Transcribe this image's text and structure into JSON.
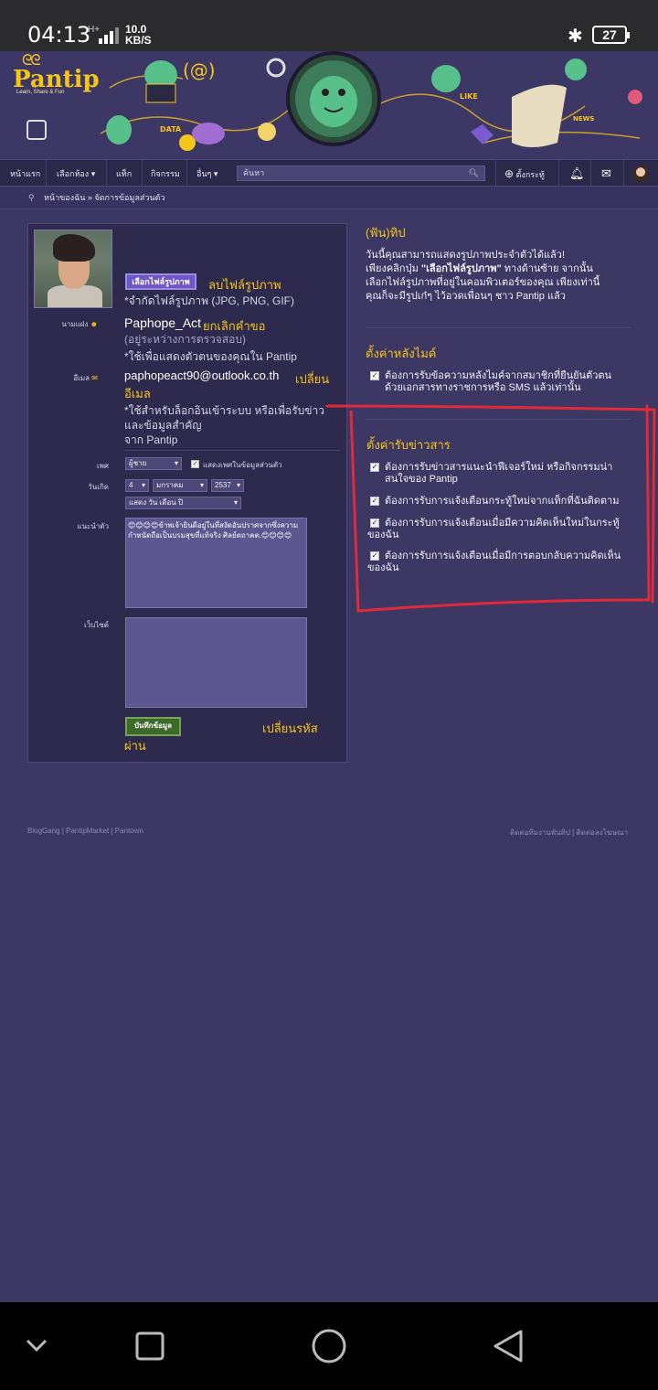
{
  "status": {
    "time": "04:13",
    "network": "H+",
    "speed_value": "10.0",
    "speed_unit": "KB/S",
    "battery": "27"
  },
  "site": {
    "name": "Pantip",
    "tagline": "Learn, Share & Fun",
    "brand_color": "#f5c518"
  },
  "nav": {
    "home": "หน้าแรก",
    "rooms": "เลือกห้อง",
    "tags": "แท็ก",
    "activities": "กิจกรรม",
    "more": "อื่นๆ",
    "search_placeholder": "ค้นหา",
    "new_topic": "ตั้งกระทู้"
  },
  "breadcrumb": "หน้าของฉัน » จัดการข้อมูลส่วนตัว",
  "profile": {
    "choose_photo": "เลือกไฟล์รูปภาพ",
    "delete_photo": "ลบไฟล์รูปภาพ",
    "photo_note": "*จำกัดไฟล์รูปภาพ (JPG, PNG, GIF)",
    "alias_label": "นามแฝง",
    "alias": "Paphope_Act",
    "cancel_request": "ยกเลิกคำขอ",
    "pending": "(อยู่ระหว่างการตรวจสอบ)",
    "alias_note": "*ใช้เพื่อแสดงตัวตนของคุณใน Pantip",
    "email_label": "อีเมล",
    "email": "paphopeact90@outlook.co.th",
    "change_email_1": "เปลี่ยน",
    "change_email_2": "อีเมล",
    "email_note_1": "*ใช้สำหรับล็อกอินเข้าระบบ หรือเพื่อรับข่าว",
    "email_note_2": "และข้อมูลสำคัญ",
    "email_note_3": "จาก Pantip",
    "gender_label": "เพศ",
    "gender": "ผู้ชาย",
    "show_gender": "แสดงเพศในข้อมูลส่วนตัว",
    "birthday_label": "วันเกิด",
    "day": "4",
    "month": "มกราคม",
    "year": "2537",
    "date_format": "แสดง วัน เดือน ปี",
    "intro_label": "แนะนำตัว",
    "intro": "😊😊😊😊ข้าพเจ้ายินดีอยู่ในที่สงัดอันปราศจากซึ่งความกำหนัดถือเป็นบรมสุขที่แท้จริง ศิลย์ตถาคต.😊😊😊😊",
    "website_label": "เว็บไซต์",
    "website": "",
    "save": "บันทึกข้อมูล",
    "change_password_1": "เปลี่ยนรหัส",
    "change_password_2": "ผ่าน"
  },
  "tips": {
    "title": "(ฟัน)ทิป",
    "line1": "วันนี้คุณสามารถแสดงรูปภาพประจำตัวได้แล้ว!",
    "line2_a": "เพียงคลิกปุ่ม ",
    "line2_b": "\"เลือกไฟล์รูปภาพ\"",
    "line2_c": " ทางด้านซ้าย จากนั้น",
    "line3": "เลือกไฟล์รูปภาพที่อยู่ในคอมพิวเตอร์ของคุณ เพียงเท่านี้",
    "line4": "คุณก็จะมีรูปเก๋ๆ ไว้อวดเพื่อนๆ ชาว Pantip แล้ว"
  },
  "mic": {
    "title": "ตั้งค่าหลังไมค์",
    "opt1_a": "ต้องการรับข้อความหลังไมค์จากสมาชิกที่ยืนยันตัวตน",
    "opt1_b": "ด้วยเอกสารทางราชการหรือ SMS แล้วเท่านั้น"
  },
  "news": {
    "title": "ตั้งค่ารับข่าวสาร",
    "opt1_a": "ต้องการรับข่าวสารแนะนำฟีเจอร์ใหม่ หรือกิจกรรมน่า",
    "opt1_b": "สนใจของ Pantip",
    "opt2": "ต้องการรับการแจ้งเตือนกระทู้ใหม่จากแท็กที่ฉันติดตาม",
    "opt3_a": "ต้องการรับการแจ้งเตือนเมื่อมีความคิดเห็นใหม่ในกระทู้",
    "opt3_b": "ของฉัน",
    "opt4_a": "ต้องการรับการแจ้งเตือนเมื่อมีการตอบกลับความคิดเห็น",
    "opt4_b": "ของฉัน"
  },
  "footer": {
    "left1": "BlogGang",
    "left2": "PantipMarket",
    "left3": "Pantown",
    "right1": "ติดต่อทีมงานพันทิป",
    "right2": "ติดต่อลงโฆษณา"
  }
}
